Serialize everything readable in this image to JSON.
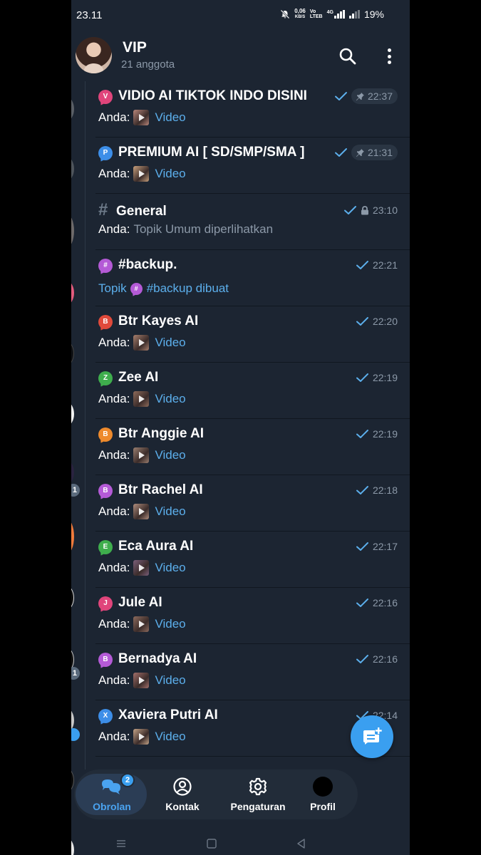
{
  "status_bar": {
    "time": "23.11",
    "net_speed_value": "0,06",
    "net_speed_unit": "KB/S",
    "volte_label": "Vo\nLTEB",
    "network_label": "4G",
    "battery": "19%"
  },
  "header": {
    "title": "VIP",
    "subtitle": "21 anggota",
    "icons": [
      "search-icon",
      "more-vertical-icon"
    ]
  },
  "topics": [
    {
      "icon_letter": "V",
      "icon_color": "#e0457b",
      "title": "VIDIO AI TIKTOK INDO DISINI",
      "time": "22:37",
      "pinned": true,
      "sender": "Anda:",
      "preview": "Video",
      "thumb": "#b8867a"
    },
    {
      "icon_letter": "P",
      "icon_color": "#3d8ee8",
      "title": "PREMIUM AI [ SD/SMP/SMA ]",
      "time": "21:31",
      "pinned": true,
      "sender": "Anda:",
      "preview": "Video",
      "thumb": "#c9a17d"
    },
    {
      "icon_letter": "#",
      "icon_color": "#6d7a89",
      "title": "General",
      "time": "23:10",
      "locked": true,
      "sender": "Anda:",
      "preview": "Topik Umum diperlihatkan"
    },
    {
      "icon_letter": "#",
      "icon_color": "#b45ad6",
      "title": "#backup.",
      "time": "22:21",
      "sender": "Topik",
      "preview": "#backup dibuat"
    },
    {
      "icon_letter": "B",
      "icon_color": "#e04a3b",
      "title": "Btr Kayes AI",
      "time": "22:20",
      "sender": "Anda:",
      "preview": "Video",
      "thumb": "#a9806e"
    },
    {
      "icon_letter": "Z",
      "icon_color": "#3fae4d",
      "title": "Zee AI",
      "time": "22:19",
      "sender": "Anda:",
      "preview": "Video",
      "thumb": "#8e6b5a"
    },
    {
      "icon_letter": "B",
      "icon_color": "#ee8a2c",
      "title": "Btr Anggie AI",
      "time": "22:19",
      "sender": "Anda:",
      "preview": "Video",
      "thumb": "#9b7f70"
    },
    {
      "icon_letter": "B",
      "icon_color": "#b45ad6",
      "title": "Btr Rachel AI",
      "time": "22:18",
      "sender": "Anda:",
      "preview": "Video",
      "thumb": "#b08d7d"
    },
    {
      "icon_letter": "E",
      "icon_color": "#3fae4d",
      "title": "Eca Aura AI",
      "time": "22:17",
      "sender": "Anda:",
      "preview": "Video",
      "thumb": "#7b5f7a"
    },
    {
      "icon_letter": "J",
      "icon_color": "#e0457b",
      "title": "Jule AI",
      "time": "22:16",
      "sender": "Anda:",
      "preview": "Video",
      "thumb": "#8d6b5d"
    },
    {
      "icon_letter": "B",
      "icon_color": "#b45ad6",
      "title": "Bernadya AI",
      "time": "22:16",
      "sender": "Anda:",
      "preview": "Video",
      "thumb": "#a36f6a"
    },
    {
      "icon_letter": "X",
      "icon_color": "#3d8ee8",
      "title": "Xaviera Putri AI",
      "time": "22:14",
      "sender": "Anda:",
      "preview": "Video",
      "thumb": "#c4a387"
    }
  ],
  "left_strip": {
    "badges": [
      "1",
      "1"
    ]
  },
  "fab": {
    "icon": "new-topic-icon",
    "color": "#3a9ff0"
  },
  "bottom_nav": {
    "chats_label": "Obrolan",
    "chats_badge": "2",
    "contacts_label": "Kontak",
    "settings_label": "Pengaturan",
    "profile_label": "Profil"
  },
  "system_nav": {
    "icons": [
      "recents-icon",
      "home-icon",
      "back-icon"
    ]
  },
  "colors": {
    "background": "#1c2532",
    "accent": "#3a9ff0",
    "link": "#5cafec",
    "muted": "#8c99a8"
  }
}
